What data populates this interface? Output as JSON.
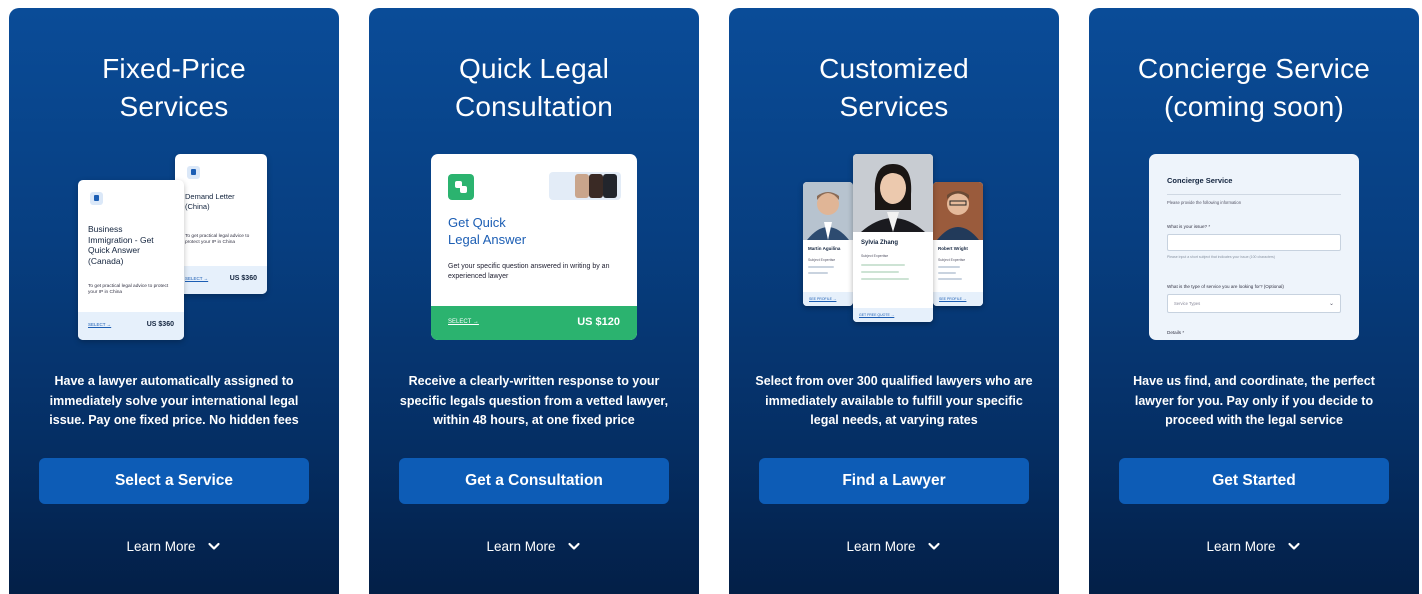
{
  "cards": [
    {
      "title": "Fixed-Price\nServices",
      "description": "Have a lawyer automatically assigned to immediately solve your international legal issue. Pay one fixed price. No hidden fees",
      "button_label": "Select a Service",
      "learn_more": "Learn More",
      "illustration": {
        "back_card": {
          "title": "Demand Letter\n(China)",
          "text": "To get practical legal advice to protect your IP in China",
          "select": "SELECT →",
          "price": "US $360"
        },
        "front_card": {
          "title": "Business\nImmigration - Get\nQuick Answer\n(Canada)",
          "text": "To get practical legal advice to protect your IP in China",
          "select": "SELECT →",
          "price": "US $360"
        }
      }
    },
    {
      "title": "Quick Legal\nConsultation",
      "description": "Receive a clearly-written response to your specific legals question from a vetted lawyer, within 48 hours, at one fixed price",
      "button_label": "Get a Consultation",
      "learn_more": "Learn More",
      "illustration": {
        "title": "Get Quick\nLegal Answer",
        "text": "Get your specific question answered in writing by an experienced lawyer",
        "select": "SELECT →",
        "price": "US $120"
      }
    },
    {
      "title": "Customized\nServices",
      "description": "Select from over 300 qualified lawyers who are immediately available to fulfill your specific legal needs, at varying rates",
      "button_label": "Find a Lawyer",
      "learn_more": "Learn More",
      "illustration": {
        "left": {
          "name": "Martin Aguilina",
          "sub": "Subject Expertise",
          "link": "SEE PROFILE →"
        },
        "center": {
          "name": "Sylvia Zhang",
          "sub": "Subject Expertise",
          "link": "GET FREE QUOTE →"
        },
        "right": {
          "name": "Robert Wright",
          "sub": "Subject Expertise",
          "link": "SEE PROFILE →"
        }
      }
    },
    {
      "title": "Concierge Service\n(coming soon)",
      "description": "Have us find, and coordinate, the perfect lawyer for you. Pay only if you decide to proceed with the legal service",
      "button_label": "Get Started",
      "learn_more": "Learn More",
      "illustration": {
        "title": "Concierge Service",
        "sub": "Please provide the following information",
        "issue_label": "What is your issue? *",
        "issue_hint": "Please input a short subject that indicates your issue (100 characters)",
        "type_label": "What is the type of service you are looking for? (Optional)",
        "type_placeholder": "Service Types",
        "details_label": "Details *"
      }
    }
  ],
  "colors": {
    "card_top": "#0a4c98",
    "card_bottom": "#031f47",
    "button": "#0d5cb6",
    "accent_green": "#2bb36f",
    "accent_blue": "#1c5eb4"
  }
}
